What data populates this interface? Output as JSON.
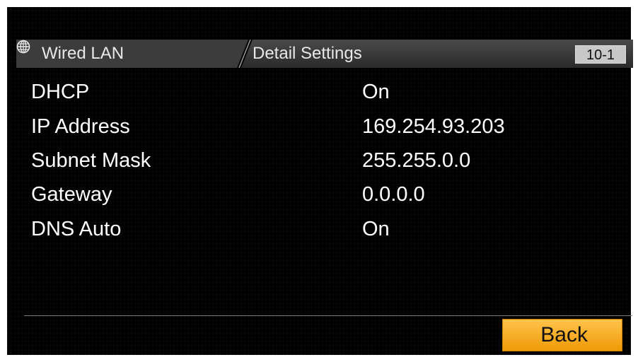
{
  "header": {
    "icon": "globe-icon",
    "section": "Wired LAN",
    "title": "Detail Settings",
    "page": "10-1"
  },
  "settings": [
    {
      "label": "DHCP",
      "value": "On"
    },
    {
      "label": "IP Address",
      "value": "169.254.93.203"
    },
    {
      "label": "Subnet Mask",
      "value": "255.255.0.0"
    },
    {
      "label": "Gateway",
      "value": "0.0.0.0"
    },
    {
      "label": "DNS Auto",
      "value": "On"
    }
  ],
  "footer": {
    "back_label": "Back"
  },
  "colors": {
    "background": "#000000",
    "header_bar": "#3a3a3a",
    "accent": "#f7a81b"
  }
}
